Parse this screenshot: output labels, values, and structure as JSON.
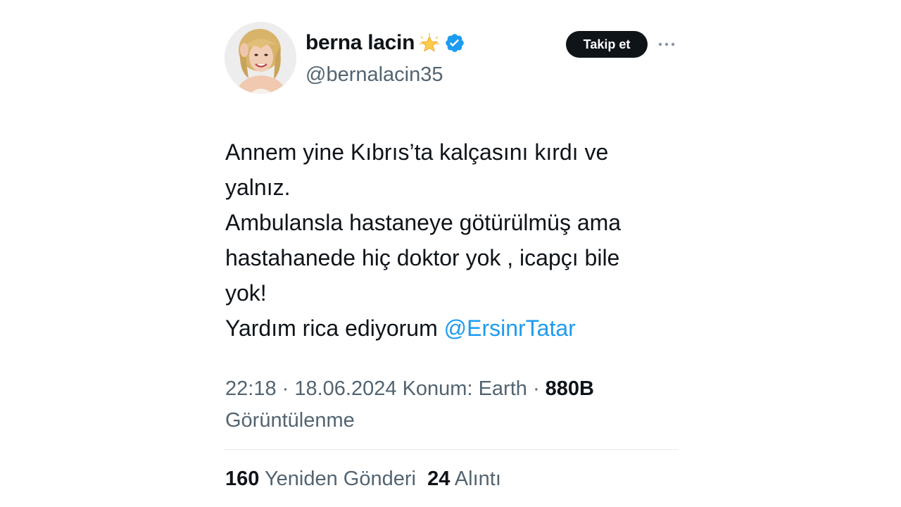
{
  "author": {
    "display_name": "berna lacin",
    "handle": "@bernalacin35",
    "star_icon": "glowing-star-icon",
    "verified_icon": "verified-badge-icon",
    "verified_color": "#1d9bf0"
  },
  "actions": {
    "follow_label": "Takip et",
    "more_icon": "ellipsis-icon"
  },
  "tweet": {
    "lines": [
      "Annem yine Kıbrıs’ta kalçasını kırdı ve",
      "yalnız.",
      "Ambulansla hastaneye götürülmüş ama",
      "hastahanede hiç doktor yok , icapçı bile",
      "yok!",
      "Yardım rica ediyorum "
    ],
    "mention": "@ErsinrTatar",
    "mention_color": "#1d9bf0"
  },
  "meta": {
    "time": "22:18",
    "sep1": " · ",
    "date": "18.06.2024",
    "location": " Konum: Earth",
    "sep2": " · ",
    "views": "880B",
    "views_label": "Görüntülenme"
  },
  "stats": {
    "reposts_count": "160",
    "reposts_label": "Yeniden Gönderi",
    "quotes_count": "24",
    "quotes_label": "Alıntı"
  }
}
